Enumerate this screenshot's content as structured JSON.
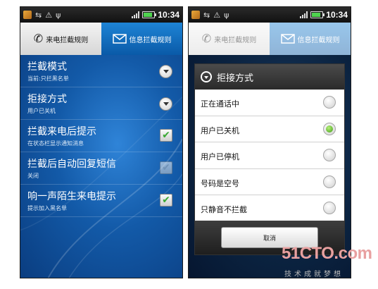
{
  "status_bar": {
    "time": "10:34"
  },
  "tabs": {
    "call_rules": "来电拦截规则",
    "sms_rules": "信息拦截规则"
  },
  "settings": [
    {
      "title": "拦截模式",
      "subtitle": "当前:只拦黑名单",
      "control": "dropdown"
    },
    {
      "title": "拒接方式",
      "subtitle": "用户已关机",
      "control": "dropdown"
    },
    {
      "title": "拦截来电后提示",
      "subtitle": "在状态栏显示通知消息",
      "control": "checkbox",
      "checked": true
    },
    {
      "title": "拦截后自动回复短信",
      "subtitle": "关闭",
      "control": "checkbox",
      "checked": false
    },
    {
      "title": "响一声陌生来电提示",
      "subtitle": "提示加入黑名单",
      "control": "checkbox",
      "checked": true
    }
  ],
  "dialog": {
    "title": "拒接方式",
    "options": [
      "正在通话中",
      "用户已关机",
      "用户已停机",
      "号码是空号",
      "只静音不拦截"
    ],
    "selected_index": 1,
    "cancel_label": "取消"
  },
  "watermark": {
    "brand": "51CTO.com",
    "slogan": "技术成就梦想"
  },
  "colors": {
    "tab_active_blue": "#0a5aa8",
    "check_green": "#38a832",
    "radio_green": "#3f9c17"
  }
}
